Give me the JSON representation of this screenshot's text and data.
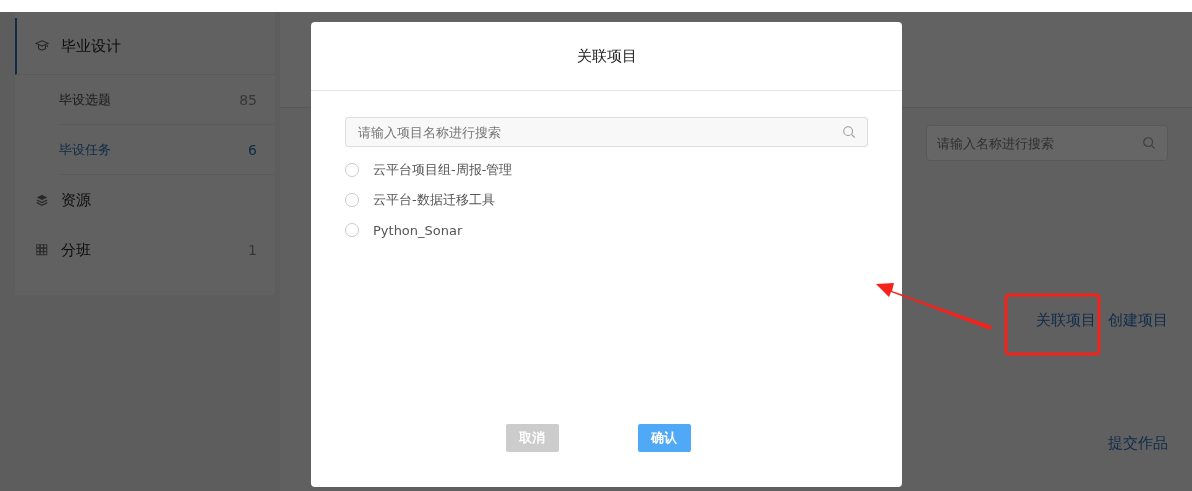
{
  "sidebar": {
    "items": [
      {
        "label": "毕业设计",
        "selected": true,
        "children": [
          {
            "label": "毕设选题",
            "count": "85",
            "selected": false
          },
          {
            "label": "毕设任务",
            "count": "6",
            "selected": true
          }
        ]
      },
      {
        "label": "资源",
        "selected": false
      },
      {
        "label": "分班",
        "count": "1",
        "selected": false
      }
    ]
  },
  "main": {
    "search": {
      "placeholder": "请输入名称进行搜索"
    },
    "actions": [
      "关联项目",
      "创建项目"
    ],
    "submit": "提交作品"
  },
  "dialog": {
    "title": "关联项目",
    "search": {
      "placeholder": "请输入项目名称进行搜索"
    },
    "options": [
      {
        "label": "云平台项目组-周报-管理",
        "selected": false
      },
      {
        "label": "云平台-数据迁移工具",
        "selected": false
      },
      {
        "label": "Python_Sonar",
        "selected": false
      }
    ],
    "buttons": [
      {
        "label": "取消",
        "kind": "cancel"
      },
      {
        "label": "确认",
        "kind": "confirm"
      }
    ]
  }
}
